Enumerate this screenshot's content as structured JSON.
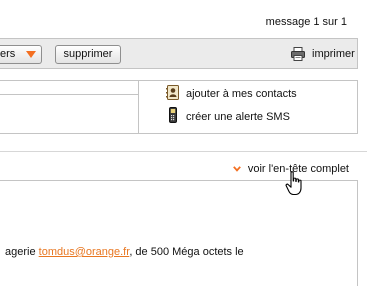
{
  "pagination": {
    "text": "message 1 sur 1"
  },
  "toolbar": {
    "folders_label": "ers",
    "delete_label": "supprimer",
    "print_label": "imprimer",
    "accent": "#f36f21"
  },
  "info_panel": {
    "add_contacts_label": "ajouter à mes contacts",
    "sms_alert_label": "créer une alerte SMS"
  },
  "full_header": {
    "label": "voir l'en-tête complet"
  },
  "message": {
    "text_before": "agerie ",
    "link_text": "tomdus@orange.fr",
    "text_after": ", de 500 Méga octets le",
    "link_color": "#e87722"
  },
  "icons": {
    "print": "printer-icon",
    "contacts": "contact-card-icon",
    "sms": "mobile-phone-icon",
    "expand": "chevron-down-icon",
    "cursor": "hand-pointer-icon"
  }
}
